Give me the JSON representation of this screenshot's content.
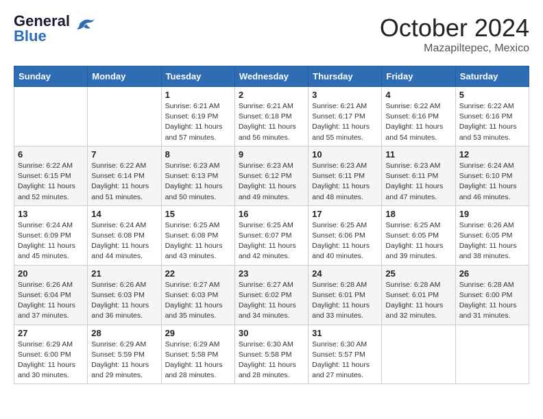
{
  "header": {
    "logo_line1": "General",
    "logo_line2": "Blue",
    "title": "October 2024",
    "subtitle": "Mazapiltepec, Mexico"
  },
  "calendar": {
    "days_of_week": [
      "Sunday",
      "Monday",
      "Tuesday",
      "Wednesday",
      "Thursday",
      "Friday",
      "Saturday"
    ],
    "weeks": [
      [
        {
          "day": "",
          "detail": ""
        },
        {
          "day": "",
          "detail": ""
        },
        {
          "day": "1",
          "detail": "Sunrise: 6:21 AM\nSunset: 6:19 PM\nDaylight: 11 hours and 57 minutes."
        },
        {
          "day": "2",
          "detail": "Sunrise: 6:21 AM\nSunset: 6:18 PM\nDaylight: 11 hours and 56 minutes."
        },
        {
          "day": "3",
          "detail": "Sunrise: 6:21 AM\nSunset: 6:17 PM\nDaylight: 11 hours and 55 minutes."
        },
        {
          "day": "4",
          "detail": "Sunrise: 6:22 AM\nSunset: 6:16 PM\nDaylight: 11 hours and 54 minutes."
        },
        {
          "day": "5",
          "detail": "Sunrise: 6:22 AM\nSunset: 6:16 PM\nDaylight: 11 hours and 53 minutes."
        }
      ],
      [
        {
          "day": "6",
          "detail": "Sunrise: 6:22 AM\nSunset: 6:15 PM\nDaylight: 11 hours and 52 minutes."
        },
        {
          "day": "7",
          "detail": "Sunrise: 6:22 AM\nSunset: 6:14 PM\nDaylight: 11 hours and 51 minutes."
        },
        {
          "day": "8",
          "detail": "Sunrise: 6:23 AM\nSunset: 6:13 PM\nDaylight: 11 hours and 50 minutes."
        },
        {
          "day": "9",
          "detail": "Sunrise: 6:23 AM\nSunset: 6:12 PM\nDaylight: 11 hours and 49 minutes."
        },
        {
          "day": "10",
          "detail": "Sunrise: 6:23 AM\nSunset: 6:11 PM\nDaylight: 11 hours and 48 minutes."
        },
        {
          "day": "11",
          "detail": "Sunrise: 6:23 AM\nSunset: 6:11 PM\nDaylight: 11 hours and 47 minutes."
        },
        {
          "day": "12",
          "detail": "Sunrise: 6:24 AM\nSunset: 6:10 PM\nDaylight: 11 hours and 46 minutes."
        }
      ],
      [
        {
          "day": "13",
          "detail": "Sunrise: 6:24 AM\nSunset: 6:09 PM\nDaylight: 11 hours and 45 minutes."
        },
        {
          "day": "14",
          "detail": "Sunrise: 6:24 AM\nSunset: 6:08 PM\nDaylight: 11 hours and 44 minutes."
        },
        {
          "day": "15",
          "detail": "Sunrise: 6:25 AM\nSunset: 6:08 PM\nDaylight: 11 hours and 43 minutes."
        },
        {
          "day": "16",
          "detail": "Sunrise: 6:25 AM\nSunset: 6:07 PM\nDaylight: 11 hours and 42 minutes."
        },
        {
          "day": "17",
          "detail": "Sunrise: 6:25 AM\nSunset: 6:06 PM\nDaylight: 11 hours and 40 minutes."
        },
        {
          "day": "18",
          "detail": "Sunrise: 6:25 AM\nSunset: 6:05 PM\nDaylight: 11 hours and 39 minutes."
        },
        {
          "day": "19",
          "detail": "Sunrise: 6:26 AM\nSunset: 6:05 PM\nDaylight: 11 hours and 38 minutes."
        }
      ],
      [
        {
          "day": "20",
          "detail": "Sunrise: 6:26 AM\nSunset: 6:04 PM\nDaylight: 11 hours and 37 minutes."
        },
        {
          "day": "21",
          "detail": "Sunrise: 6:26 AM\nSunset: 6:03 PM\nDaylight: 11 hours and 36 minutes."
        },
        {
          "day": "22",
          "detail": "Sunrise: 6:27 AM\nSunset: 6:03 PM\nDaylight: 11 hours and 35 minutes."
        },
        {
          "day": "23",
          "detail": "Sunrise: 6:27 AM\nSunset: 6:02 PM\nDaylight: 11 hours and 34 minutes."
        },
        {
          "day": "24",
          "detail": "Sunrise: 6:28 AM\nSunset: 6:01 PM\nDaylight: 11 hours and 33 minutes."
        },
        {
          "day": "25",
          "detail": "Sunrise: 6:28 AM\nSunset: 6:01 PM\nDaylight: 11 hours and 32 minutes."
        },
        {
          "day": "26",
          "detail": "Sunrise: 6:28 AM\nSunset: 6:00 PM\nDaylight: 11 hours and 31 minutes."
        }
      ],
      [
        {
          "day": "27",
          "detail": "Sunrise: 6:29 AM\nSunset: 6:00 PM\nDaylight: 11 hours and 30 minutes."
        },
        {
          "day": "28",
          "detail": "Sunrise: 6:29 AM\nSunset: 5:59 PM\nDaylight: 11 hours and 29 minutes."
        },
        {
          "day": "29",
          "detail": "Sunrise: 6:29 AM\nSunset: 5:58 PM\nDaylight: 11 hours and 28 minutes."
        },
        {
          "day": "30",
          "detail": "Sunrise: 6:30 AM\nSunset: 5:58 PM\nDaylight: 11 hours and 28 minutes."
        },
        {
          "day": "31",
          "detail": "Sunrise: 6:30 AM\nSunset: 5:57 PM\nDaylight: 11 hours and 27 minutes."
        },
        {
          "day": "",
          "detail": ""
        },
        {
          "day": "",
          "detail": ""
        }
      ]
    ]
  }
}
